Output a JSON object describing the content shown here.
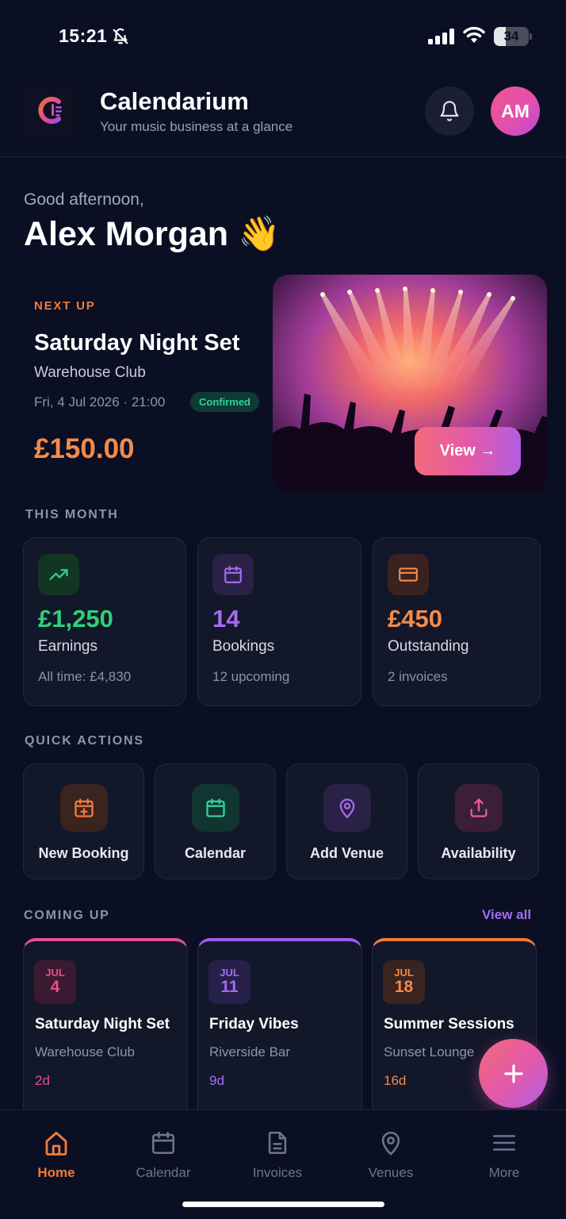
{
  "status_bar": {
    "time": "15:21",
    "battery": "34",
    "battery_level": 0.34
  },
  "header": {
    "title": "Calendarium",
    "subtitle": "Your music business at a glance",
    "avatar_initials": "AM"
  },
  "greeting": {
    "salutation": "Good afternoon,",
    "name": "Alex Morgan 👋"
  },
  "next_up": {
    "label": "NEXT UP",
    "title": "Saturday Night Set",
    "venue": "Warehouse Club",
    "datetime": "Fri, 4 Jul 2026 · 21:00",
    "status": "Confirmed",
    "amount": "£150.00",
    "view_label": "View →"
  },
  "this_month": {
    "label": "THIS MONTH",
    "stats": [
      {
        "value": "£1,250",
        "label": "Earnings",
        "sub": "All time: £4,830",
        "icon": "trending-up-icon",
        "color": "#2ed17a"
      },
      {
        "value": "14",
        "label": "Bookings",
        "sub": "12 upcoming",
        "icon": "calendar-icon",
        "color": "#a66cf0"
      },
      {
        "value": "£450",
        "label": "Outstanding",
        "sub": "2 invoices",
        "icon": "credit-card-icon",
        "color": "#f38b4a"
      }
    ]
  },
  "quick_actions": {
    "label": "QUICK ACTIONS",
    "items": [
      {
        "label": "New Booking",
        "icon": "calendar-plus-icon",
        "color": "#f07a3a"
      },
      {
        "label": "Calendar",
        "icon": "calendar-icon",
        "color": "#2ed1a0"
      },
      {
        "label": "Add Venue",
        "icon": "map-pin-icon",
        "color": "#a66cf0"
      },
      {
        "label": "Availability",
        "icon": "share-upload-icon",
        "color": "#e85aa6"
      }
    ]
  },
  "coming_up": {
    "label": "COMING UP",
    "view_all": "View all",
    "events": [
      {
        "month": "JUL",
        "day": "4",
        "title": "Saturday Night Set",
        "venue": "Warehouse Club",
        "countdown": "2d",
        "color": "#e84f8f"
      },
      {
        "month": "JUL",
        "day": "11",
        "title": "Friday Vibes",
        "venue": "Riverside Bar",
        "countdown": "9d",
        "color": "#9d5cf0"
      },
      {
        "month": "JUL",
        "day": "18",
        "title": "Summer Sessions",
        "venue": "Sunset Lounge",
        "countdown": "16d",
        "color": "#f07a3a"
      }
    ]
  },
  "bottom_nav": {
    "items": [
      {
        "label": "Home",
        "icon": "home-icon",
        "active": true
      },
      {
        "label": "Calendar",
        "icon": "calendar-icon",
        "active": false
      },
      {
        "label": "Invoices",
        "icon": "document-icon",
        "active": false
      },
      {
        "label": "Venues",
        "icon": "map-pin-icon",
        "active": false
      },
      {
        "label": "More",
        "icon": "menu-icon",
        "active": false
      }
    ]
  },
  "colors": {
    "accent_orange": "#f07a3a",
    "accent_pink": "#e45aa6",
    "accent_purple": "#a76cf0",
    "background": "#0b0f24"
  }
}
